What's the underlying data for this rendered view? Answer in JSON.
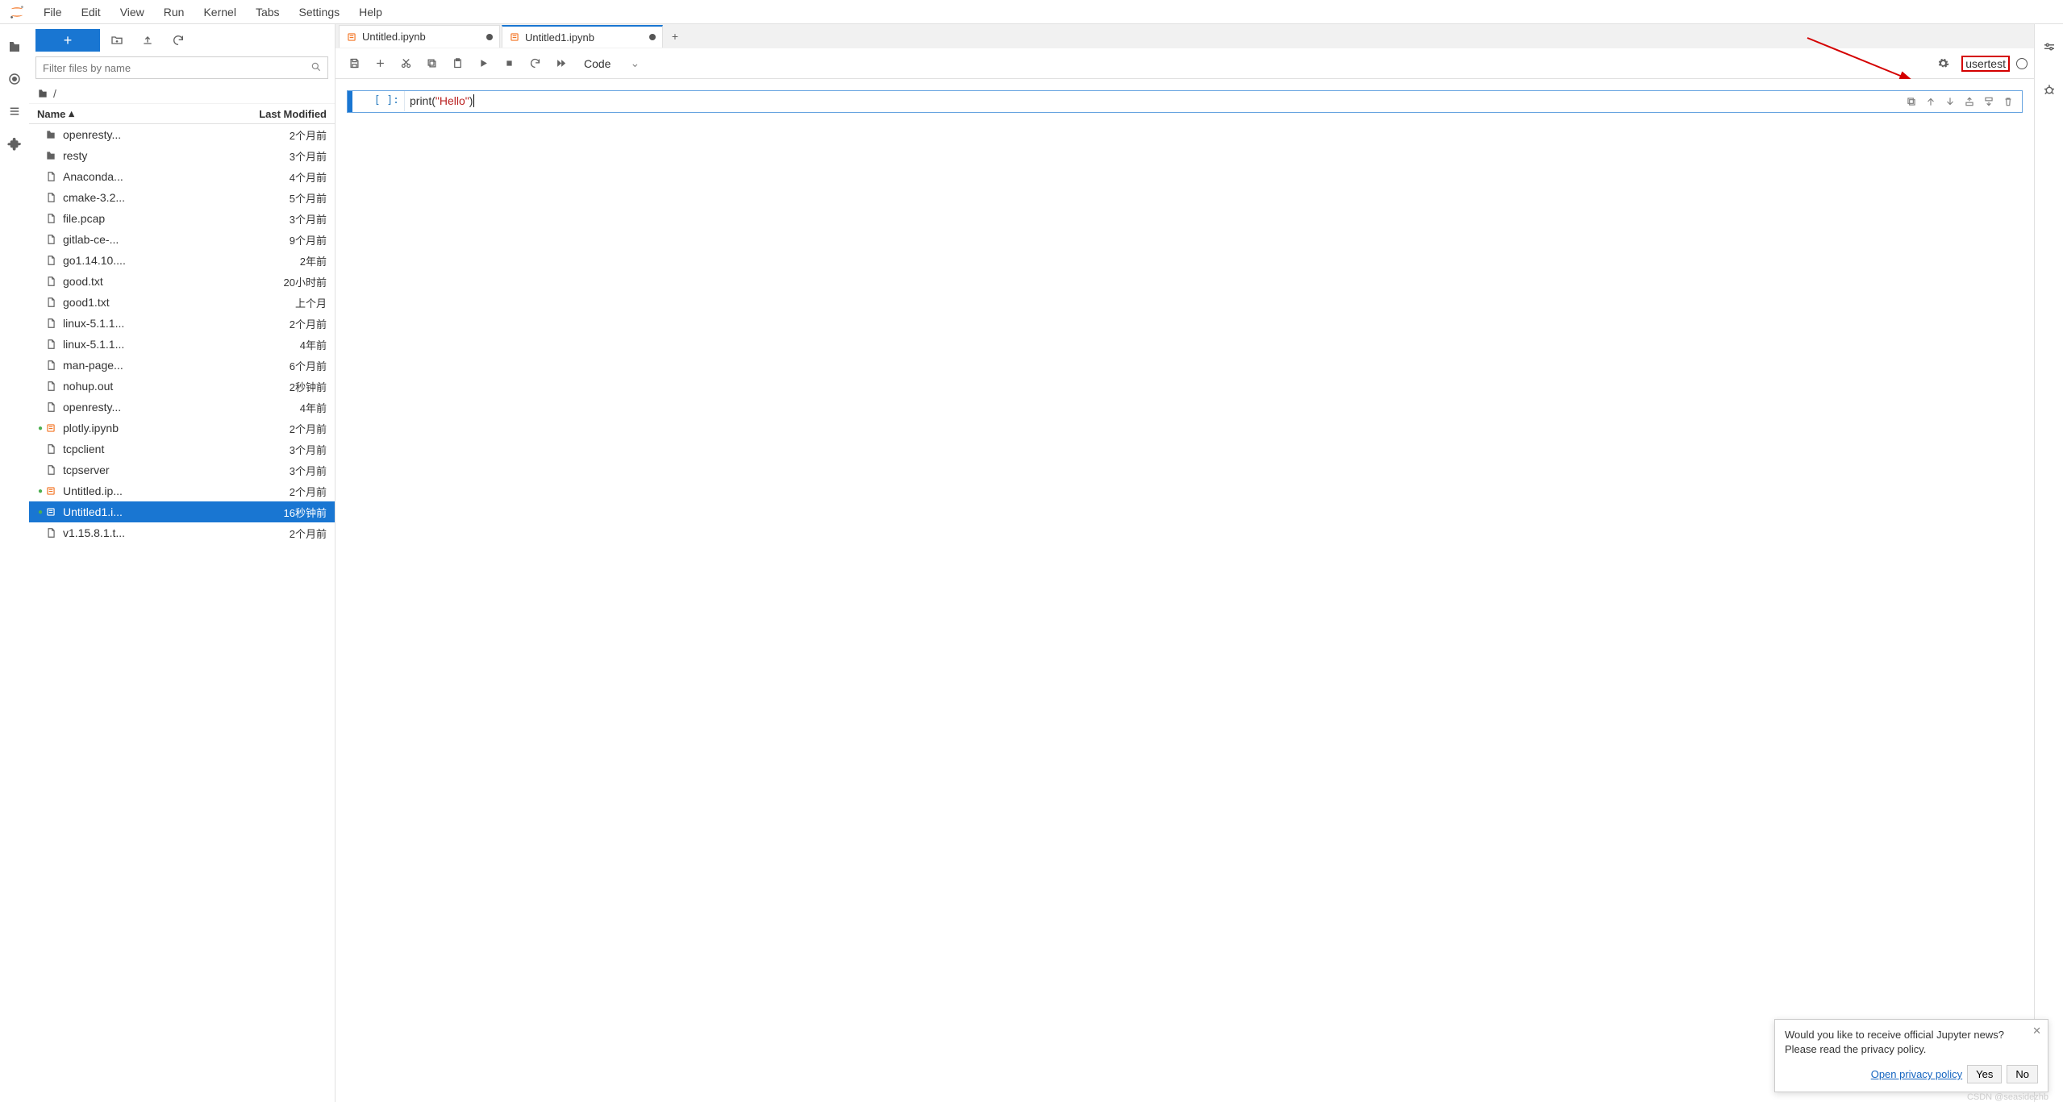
{
  "menu": [
    "File",
    "Edit",
    "View",
    "Run",
    "Kernel",
    "Tabs",
    "Settings",
    "Help"
  ],
  "fb": {
    "search_placeholder": "Filter files by name",
    "breadcrumb": "/",
    "header_name": "Name",
    "header_mod": "Last Modified",
    "items": [
      {
        "type": "folder",
        "name": "openresty...",
        "mod": "2个月前",
        "running": false
      },
      {
        "type": "folder",
        "name": "resty",
        "mod": "3个月前",
        "running": false
      },
      {
        "type": "file",
        "name": "Anaconda...",
        "mod": "4个月前",
        "running": false
      },
      {
        "type": "file",
        "name": "cmake-3.2...",
        "mod": "5个月前",
        "running": false
      },
      {
        "type": "file",
        "name": "file.pcap",
        "mod": "3个月前",
        "running": false
      },
      {
        "type": "file",
        "name": "gitlab-ce-...",
        "mod": "9个月前",
        "running": false
      },
      {
        "type": "file",
        "name": "go1.14.10....",
        "mod": "2年前",
        "running": false
      },
      {
        "type": "file",
        "name": "good.txt",
        "mod": "20小时前",
        "running": false
      },
      {
        "type": "file",
        "name": "good1.txt",
        "mod": "上个月",
        "running": false
      },
      {
        "type": "file",
        "name": "linux-5.1.1...",
        "mod": "2个月前",
        "running": false
      },
      {
        "type": "file",
        "name": "linux-5.1.1...",
        "mod": "4年前",
        "running": false
      },
      {
        "type": "file",
        "name": "man-page...",
        "mod": "6个月前",
        "running": false
      },
      {
        "type": "file",
        "name": "nohup.out",
        "mod": "2秒钟前",
        "running": false
      },
      {
        "type": "file",
        "name": "openresty...",
        "mod": "4年前",
        "running": false
      },
      {
        "type": "nb",
        "name": "plotly.ipynb",
        "mod": "2个月前",
        "running": true
      },
      {
        "type": "file",
        "name": "tcpclient",
        "mod": "3个月前",
        "running": false
      },
      {
        "type": "file",
        "name": "tcpserver",
        "mod": "3个月前",
        "running": false
      },
      {
        "type": "nb",
        "name": "Untitled.ip...",
        "mod": "2个月前",
        "running": true
      },
      {
        "type": "nb",
        "name": "Untitled1.i...",
        "mod": "16秒钟前",
        "running": true,
        "selected": true
      },
      {
        "type": "file",
        "name": "v1.15.8.1.t...",
        "mod": "2个月前",
        "running": false
      }
    ]
  },
  "tabs": [
    {
      "label": "Untitled.ipynb",
      "active": false,
      "dirty": true
    },
    {
      "label": "Untitled1.ipynb",
      "active": true,
      "dirty": true
    }
  ],
  "nb_toolbar": {
    "cell_type": "Code",
    "kernel_name": "usertest"
  },
  "cell": {
    "prompt": "[ ]:",
    "code_prefix": "print(",
    "code_str": "\"Hello\"",
    "code_suffix": ")"
  },
  "notif": {
    "line1": "Would you like to receive official Jupyter news?",
    "line2": "Please read the privacy policy.",
    "open_policy": "Open privacy policy",
    "yes": "Yes",
    "no": "No"
  },
  "watermark": "CSDN @seasidezhb"
}
